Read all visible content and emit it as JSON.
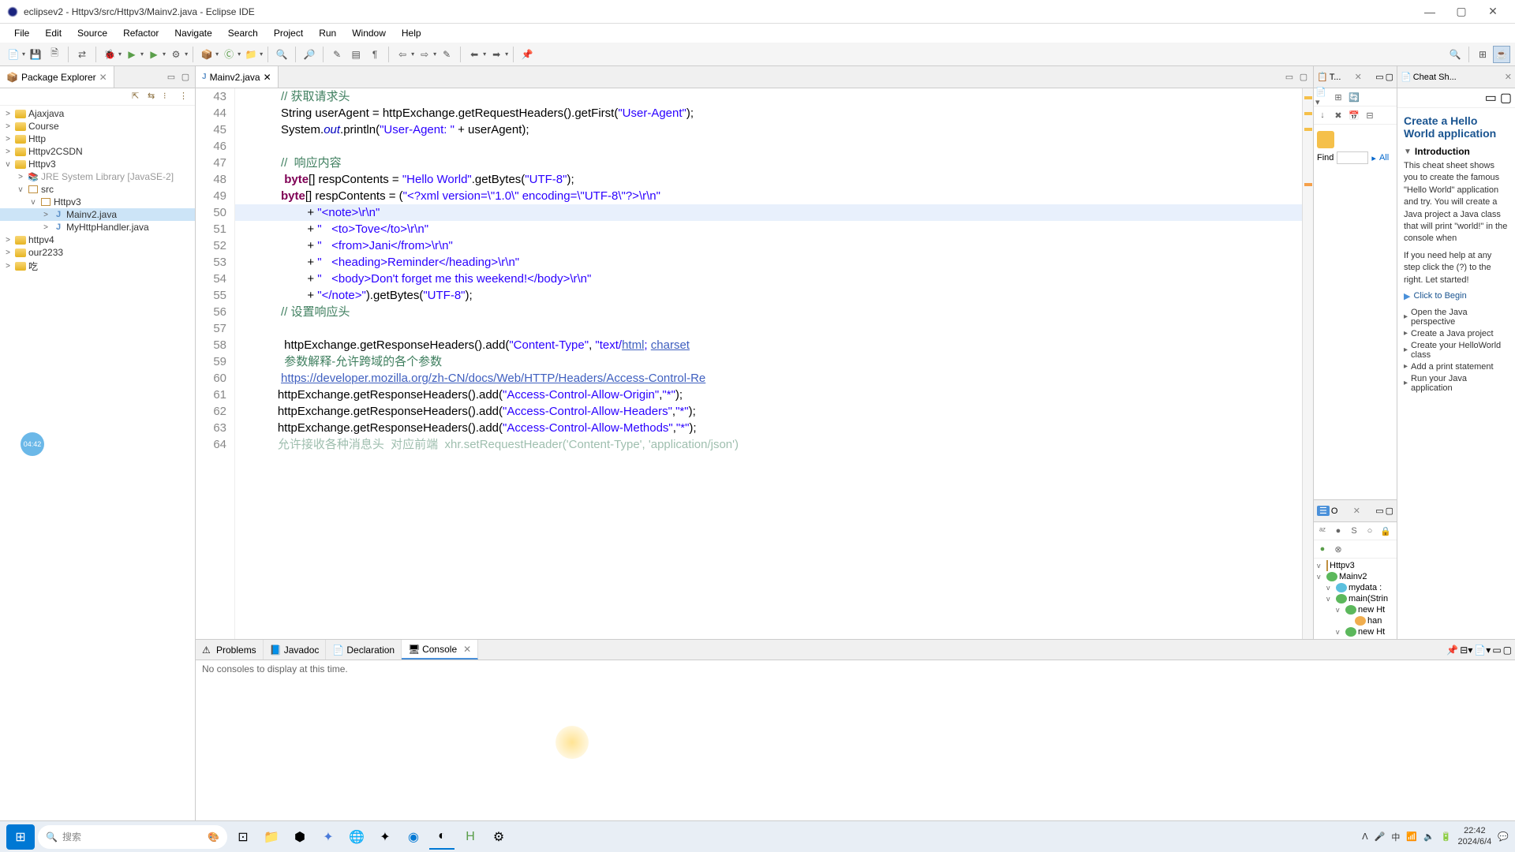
{
  "titlebar": {
    "title": "eclipsev2 - Httpv3/src/Httpv3/Mainv2.java - Eclipse IDE"
  },
  "menu": [
    "File",
    "Edit",
    "Source",
    "Refactor",
    "Navigate",
    "Search",
    "Project",
    "Run",
    "Window",
    "Help"
  ],
  "package_explorer": {
    "title": "Package Explorer",
    "items": [
      {
        "indent": 0,
        "expand": ">",
        "icon": "folder",
        "label": "Ajaxjava"
      },
      {
        "indent": 0,
        "expand": ">",
        "icon": "folder",
        "label": "Course"
      },
      {
        "indent": 0,
        "expand": ">",
        "icon": "folder",
        "label": "Http"
      },
      {
        "indent": 0,
        "expand": ">",
        "icon": "folder",
        "label": "Httpv2CSDN"
      },
      {
        "indent": 0,
        "expand": "v",
        "icon": "folder",
        "label": "Httpv3"
      },
      {
        "indent": 1,
        "expand": ">",
        "icon": "lib",
        "label": "JRE System Library [JavaSE-2]",
        "gray": true
      },
      {
        "indent": 1,
        "expand": "v",
        "icon": "pkg",
        "label": "src"
      },
      {
        "indent": 2,
        "expand": "v",
        "icon": "pkg",
        "label": "Httpv3"
      },
      {
        "indent": 3,
        "expand": ">",
        "icon": "java",
        "label": "Mainv2.java",
        "selected": true
      },
      {
        "indent": 3,
        "expand": ">",
        "icon": "java",
        "label": "MyHttpHandler.java"
      },
      {
        "indent": 0,
        "expand": ">",
        "icon": "folder",
        "label": "httpv4"
      },
      {
        "indent": 0,
        "expand": ">",
        "icon": "folder",
        "label": "our2233"
      },
      {
        "indent": 0,
        "expand": ">",
        "icon": "folder",
        "label": "吃"
      }
    ]
  },
  "editor": {
    "tab": "Mainv2.java",
    "first_line": 43,
    "lines": [
      {
        "n": 43,
        "html": "            <span class='c-comment'>// 获取请求头</span>"
      },
      {
        "n": 44,
        "html": "            String userAgent = httpExchange.getRequestHeaders().getFirst(<span class='c-string'>\"User-Agent\"</span>);"
      },
      {
        "n": 45,
        "html": "            System.<span class='c-field'>out</span>.println(<span class='c-string'>\"User-Agent: \"</span> + userAgent);"
      },
      {
        "n": 46,
        "html": ""
      },
      {
        "n": 47,
        "html": "            <span class='c-comment'>//  响应内容</span>"
      },
      {
        "n": 48,
        "html": "             <span class='c-keyword'>byte</span>[] respContents = <span class='c-string'>\"Hello World\"</span>.getBytes(<span class='c-string'>\"UTF-8\"</span>);"
      },
      {
        "n": 49,
        "html": "            <span class='c-keyword'>byte</span>[] respContents = (<span class='c-string'>\"&lt;?xml version=\\\"1.0\\\" encoding=\\\"UTF-8\\\"?&gt;\\r\\n\"</span>"
      },
      {
        "n": 50,
        "html": "                    + <span class='c-string'>\"&lt;note&gt;\\r\\n\"</span>",
        "hl": true
      },
      {
        "n": 51,
        "html": "                    + <span class='c-string'>\"   &lt;to&gt;Tove&lt;/to&gt;\\r\\n\"</span>"
      },
      {
        "n": 52,
        "html": "                    + <span class='c-string'>\"   &lt;from&gt;Jani&lt;/from&gt;\\r\\n\"</span>"
      },
      {
        "n": 53,
        "html": "                    + <span class='c-string'>\"   &lt;heading&gt;Reminder&lt;/heading&gt;\\r\\n\"</span>"
      },
      {
        "n": 54,
        "html": "                    + <span class='c-string'>\"   &lt;body&gt;Don't forget me this weekend!&lt;/body&gt;\\r\\n\"</span>"
      },
      {
        "n": 55,
        "html": "                    + <span class='c-string'>\"&lt;/note&gt;\"</span>).getBytes(<span class='c-string'>\"UTF-8\"</span>);"
      },
      {
        "n": 56,
        "html": "            <span class='c-comment'>// 设置响应头</span>"
      },
      {
        "n": 57,
        "html": ""
      },
      {
        "n": 58,
        "html": "             httpExchange.getResponseHeaders().add(<span class='c-string'>\"Content-Type\"</span>, <span class='c-string'>\"text/<span class='c-link'>html</span>; <span class='c-link'>charset</span></span>"
      },
      {
        "n": 59,
        "html": "             <span class='c-comment'>参数解释-允许跨域的各个参数</span>"
      },
      {
        "n": 60,
        "html": "            <span class='c-link'>https://developer.mozilla.org/zh-CN/docs/Web/HTTP/Headers/Access-Control-Re</span>"
      },
      {
        "n": 61,
        "html": "           httpExchange.getResponseHeaders().add(<span class='c-string'>\"Access-Control-Allow-Origin\"</span>,<span class='c-string'>\"*\"</span>);"
      },
      {
        "n": 62,
        "html": "           httpExchange.getResponseHeaders().add(<span class='c-string'>\"Access-Control-Allow-Headers\"</span>,<span class='c-string'>\"*\"</span>);"
      },
      {
        "n": 63,
        "html": "           httpExchange.getResponseHeaders().add(<span class='c-string'>\"Access-Control-Allow-Methods\"</span>,<span class='c-string'>\"*\"</span>);"
      },
      {
        "n": 64,
        "html": "           <span class='c-comment' style='opacity:.5'>允许接收各种消息头  对应前端  xhr.setRequestHeader('Content-Type', 'application/json')</span>"
      }
    ]
  },
  "bottom": {
    "tabs": [
      "Problems",
      "Javadoc",
      "Declaration",
      "Console"
    ],
    "active": 3,
    "content": "No consoles to display at this time."
  },
  "tasks_view": {
    "tab": "T...",
    "find_label": "Find",
    "all_label": "All"
  },
  "cheat": {
    "tab": "Cheat Sh...",
    "title": "Create a Hello World application",
    "intro_title": "Introduction",
    "intro_text": "This cheat sheet shows you to create the famous \"Hello World\" application and try. You will create a Java project a Java class that will print \"world!\" in the console when",
    "help_text": "If you need help at any step click the (?) to the right. Let started!",
    "begin": "Click to Begin",
    "steps": [
      "Open the Java perspective",
      "Create a Java project",
      "Create your HelloWorld class",
      "Add a print statement",
      "Run your Java application"
    ]
  },
  "outline": {
    "tab_icon": "O",
    "items": [
      {
        "indent": 0,
        "icon": "pkg",
        "label": "Httpv3"
      },
      {
        "indent": 0,
        "icon": "green",
        "label": "Mainv2"
      },
      {
        "indent": 1,
        "icon": "blue",
        "label": "mydata :"
      },
      {
        "indent": 1,
        "icon": "green",
        "label": "main(Strin"
      },
      {
        "indent": 2,
        "icon": "green",
        "label": "new Ht"
      },
      {
        "indent": 3,
        "icon": "orange",
        "label": "han"
      },
      {
        "indent": 2,
        "icon": "green",
        "label": "new Ht"
      }
    ]
  },
  "taskbar": {
    "search_placeholder": "搜索",
    "ime": "中",
    "time": "22:42",
    "date": "2024/6/4"
  },
  "timer": "04:42"
}
